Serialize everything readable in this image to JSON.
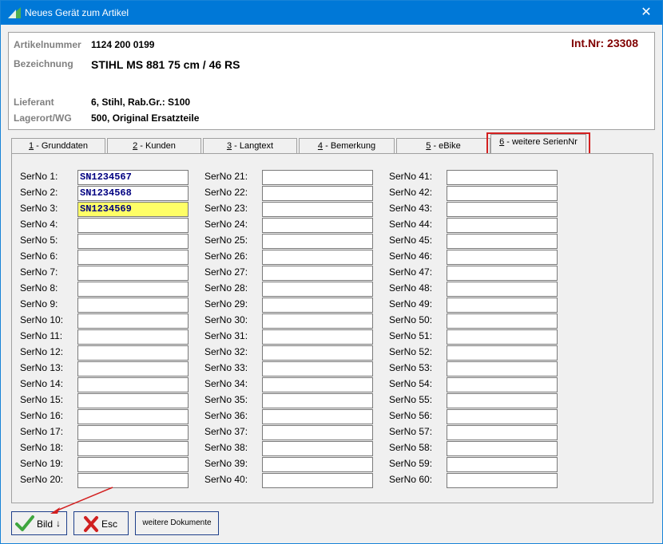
{
  "window": {
    "title": "Neues Gerät zum Artikel",
    "close_symbol": "✕"
  },
  "header": {
    "artikelnummer_label": "Artikelnummer",
    "artikelnummer_value": "1124 200 0199",
    "bezeichnung_label": "Bezeichnung",
    "bezeichnung_value": "STIHL MS 881 75 cm / 46 RS",
    "lieferant_label": "Lieferant",
    "lieferant_value": "6, Stihl, Rab.Gr.: S100",
    "lagerort_label": "Lagerort/WG",
    "lagerort_value": "500, Original Ersatzteile",
    "intnr": "Int.Nr: 23308"
  },
  "tabs": [
    {
      "key": "1",
      "label": " - Grunddaten"
    },
    {
      "key": "2",
      "label": " - Kunden"
    },
    {
      "key": "3",
      "label": " - Langtext"
    },
    {
      "key": "4",
      "label": " - Bemerkung"
    },
    {
      "key": "5",
      "label": " - eBike"
    },
    {
      "key": "6",
      "label": " - weitere SerienNr"
    }
  ],
  "active_tab": "6",
  "serials": {
    "labels": [
      "SerNo 1:",
      "SerNo 2:",
      "SerNo 3:",
      "SerNo 4:",
      "SerNo 5:",
      "SerNo 6:",
      "SerNo 7:",
      "SerNo 8:",
      "SerNo 9:",
      "SerNo 10:",
      "SerNo 11:",
      "SerNo 12:",
      "SerNo 13:",
      "SerNo 14:",
      "SerNo 15:",
      "SerNo 16:",
      "SerNo 17:",
      "SerNo 18:",
      "SerNo 19:",
      "SerNo 20:",
      "SerNo 21:",
      "SerNo 22:",
      "SerNo 23:",
      "SerNo 24:",
      "SerNo 25:",
      "SerNo 26:",
      "SerNo 27:",
      "SerNo 28:",
      "SerNo 29:",
      "SerNo 30:",
      "SerNo 31:",
      "SerNo 32:",
      "SerNo 33:",
      "SerNo 34:",
      "SerNo 35:",
      "SerNo 36:",
      "SerNo 37:",
      "SerNo 38:",
      "SerNo 39:",
      "SerNo 40:",
      "SerNo 41:",
      "SerNo 42:",
      "SerNo 43:",
      "SerNo 44:",
      "SerNo 45:",
      "SerNo 46:",
      "SerNo 47:",
      "SerNo 48:",
      "SerNo 49:",
      "SerNo 50:",
      "SerNo 51:",
      "SerNo 52:",
      "SerNo 53:",
      "SerNo 54:",
      "SerNo 55:",
      "SerNo 56:",
      "SerNo 57:",
      "SerNo 58:",
      "SerNo 59:",
      "SerNo 60:"
    ],
    "values": [
      "SN1234567",
      "SN1234568",
      "SN1234569",
      "",
      "",
      "",
      "",
      "",
      "",
      "",
      "",
      "",
      "",
      "",
      "",
      "",
      "",
      "",
      "",
      "",
      "",
      "",
      "",
      "",
      "",
      "",
      "",
      "",
      "",
      "",
      "",
      "",
      "",
      "",
      "",
      "",
      "",
      "",
      "",
      "",
      "",
      "",
      "",
      "",
      "",
      "",
      "",
      "",
      "",
      "",
      "",
      "",
      "",
      "",
      "",
      "",
      "",
      "",
      "",
      ""
    ],
    "focused_index": 2
  },
  "buttons": {
    "bild_label": "Bild",
    "bild_arrow": "↓",
    "esc_label": "Esc",
    "dokumente_label": "weitere Dokumente"
  },
  "colors": {
    "titlebar": "#0078d7",
    "intnr": "#800000",
    "focused_field": "#ffff66",
    "highlight_box": "#d32020"
  }
}
